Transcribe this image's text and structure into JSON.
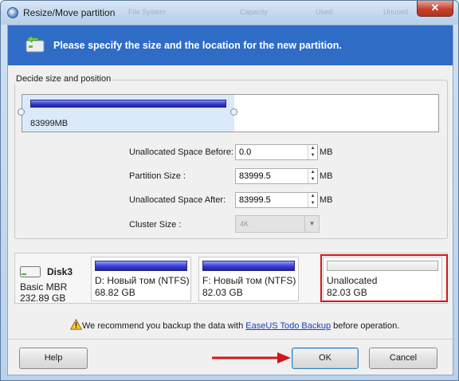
{
  "window": {
    "title": "Resize/Move partition",
    "close_symbol": "✕",
    "background_header": [
      "File System",
      "Capacity",
      "Used",
      "Unused"
    ]
  },
  "banner": {
    "text": "Please specify the size and the location for the new partition.",
    "icon": "partition-resize-icon",
    "color": "#2f6cc6"
  },
  "sizing": {
    "group_label": "Decide size and position",
    "bar_size_label": "83999MB",
    "fields": [
      {
        "label": "Unallocated Space Before:",
        "value": "0.0",
        "unit": "MB"
      },
      {
        "label": "Partition Size :",
        "value": "83999.5",
        "unit": "MB"
      },
      {
        "label": "Unallocated Space After:",
        "value": "83999.5",
        "unit": "MB"
      }
    ],
    "cluster": {
      "label": "Cluster Size :",
      "value": "4K"
    }
  },
  "disk": {
    "name": "Disk3",
    "type": "Basic MBR",
    "size": "232.89 GB",
    "partitions": [
      {
        "name": "D: Новый том (NTFS)",
        "size": "68.82 GB"
      },
      {
        "name": "F: Новый том (NTFS)",
        "size": "82.03 GB"
      },
      {
        "name": "Unallocated",
        "size": "82.03 GB"
      }
    ],
    "highlight_color": "#d01818"
  },
  "warning": {
    "prefix": "We recommend you backup the data with ",
    "link": "EaseUS Todo Backup",
    "suffix": " before operation."
  },
  "buttons": {
    "help": "Help",
    "ok": "OK",
    "cancel": "Cancel"
  },
  "annotation": {
    "arrow_color": "#d01818"
  }
}
